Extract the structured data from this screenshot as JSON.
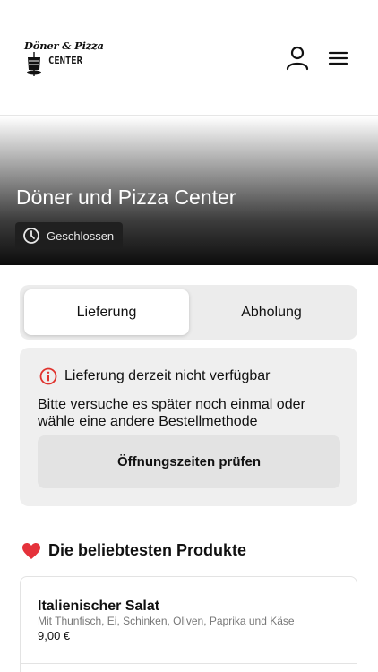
{
  "header": {
    "logo_line1": "Döner & Pizza",
    "logo_line2": "CENTER",
    "account_icon": "user-icon",
    "menu_icon": "hamburger-menu-icon"
  },
  "hero": {
    "title": "Döner und Pizza Center",
    "status": "Geschlossen",
    "status_icon": "clock-icon"
  },
  "order_mode": {
    "tabs": [
      {
        "label": "Lieferung",
        "active": true
      },
      {
        "label": "Abholung",
        "active": false
      }
    ]
  },
  "notice": {
    "icon": "info-icon",
    "icon_color": "#e0322d",
    "title": "Lieferung derzeit nicht verfügbar",
    "body": "Bitte versuche es später noch einmal oder wähle eine andere Bestellmethode",
    "button_label": "Öffnungszeiten prüfen"
  },
  "popular": {
    "icon": "heart-icon",
    "title": "Die beliebtesten Produkte",
    "products": [
      {
        "name": "Italienischer Salat",
        "description": "Mit Thunfisch, Ei, Schinken, Oliven, Paprika und Käse",
        "price": "9,00 €"
      }
    ]
  },
  "colors": {
    "accent_red": "#e0322d",
    "heart_red": "#e5323b"
  }
}
